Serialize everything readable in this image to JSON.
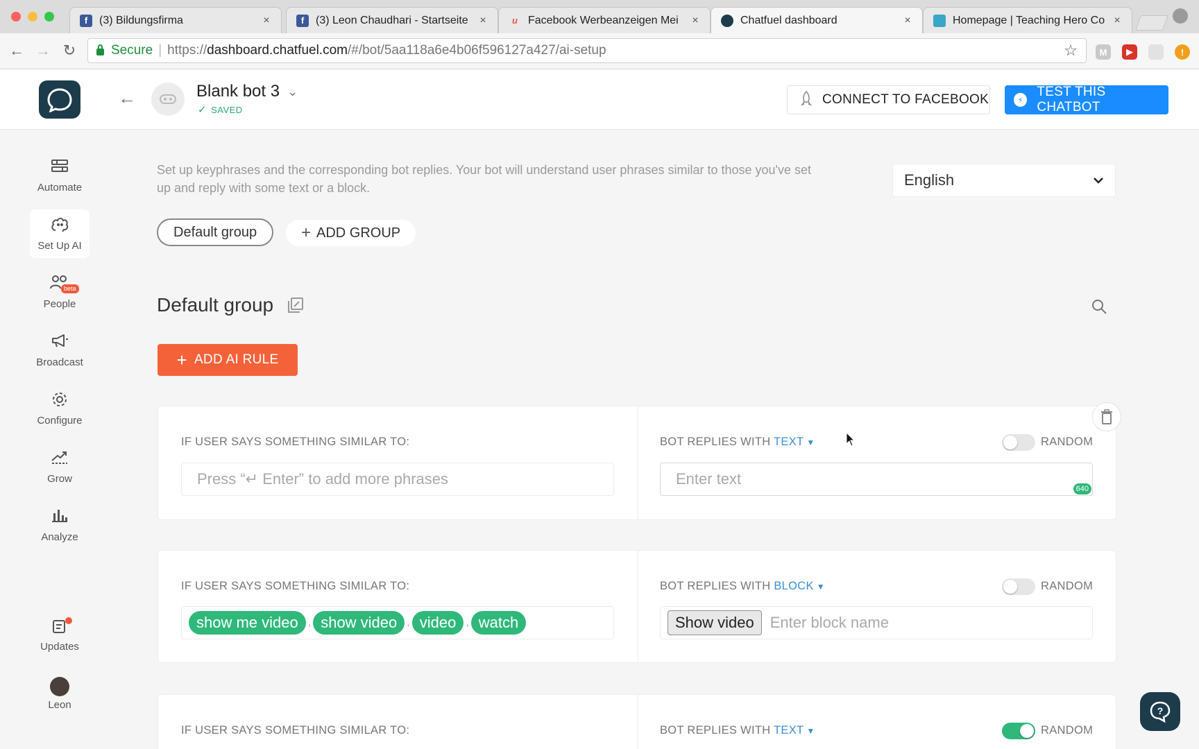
{
  "browser": {
    "tabs": [
      {
        "title": "(3) Bildungsfirma",
        "favicon": "facebook-icon",
        "color": "#3b5998"
      },
      {
        "title": "(3) Leon Chaudhari - Startseite",
        "favicon": "facebook-icon",
        "color": "#3b5998"
      },
      {
        "title": "Facebook Werbeanzeigen Mei",
        "favicon": "udemy-icon",
        "color": "#ec5252"
      },
      {
        "title": "Chatfuel dashboard",
        "favicon": "chatfuel-icon",
        "color": "#1c3c4c"
      },
      {
        "title": "Homepage | Teaching Hero Co",
        "favicon": "teachinghero-icon",
        "color": "#3aa6c8"
      }
    ],
    "tab_close": "×",
    "url": {
      "secure_label": "Secure",
      "scheme": "https://",
      "host": "dashboard.chatfuel.com",
      "path": "/#/bot/5aa118a6e4b06f596127a427/ai-setup"
    }
  },
  "header": {
    "bot_name": "Blank bot 3",
    "saved_label": "SAVED",
    "connect_label": "CONNECT TO FACEBOOK",
    "test_label": "TEST THIS CHATBOT",
    "accent": "#1a8cff"
  },
  "sidebar": {
    "items": [
      {
        "label": "Automate",
        "icon": "automate-icon"
      },
      {
        "label": "Set Up AI",
        "icon": "ai-brain-icon",
        "active": true
      },
      {
        "label": "People",
        "icon": "people-icon",
        "badge": "beta"
      },
      {
        "label": "Broadcast",
        "icon": "megaphone-icon"
      },
      {
        "label": "Configure",
        "icon": "gear-icon"
      },
      {
        "label": "Grow",
        "icon": "grow-icon"
      },
      {
        "label": "Analyze",
        "icon": "bar-chart-icon"
      },
      {
        "label": "Updates",
        "icon": "updates-icon"
      },
      {
        "label": "Leon",
        "icon": "user-avatar"
      }
    ]
  },
  "main": {
    "intro": "Set up keyphrases and the corresponding bot replies. Your bot will understand user phrases similar to those you've set up and reply with some text or a block.",
    "language": "English",
    "groups": [
      "Default group"
    ],
    "add_group_label": "ADD GROUP",
    "group_title": "Default group",
    "add_rule_label": "ADD AI RULE",
    "rules": [
      {
        "user_label": "IF USER SAYS SOMETHING SIMILAR TO:",
        "bot_label": "BOT REPLIES WITH",
        "reply_type": "TEXT",
        "random_label": "RANDOM",
        "random_on": false,
        "phrase_placeholder": "Press “↵ Enter” to add more phrases",
        "reply_placeholder": "Enter text",
        "char_limit": "640",
        "phrases": []
      },
      {
        "user_label": "IF USER SAYS SOMETHING SIMILAR TO:",
        "bot_label": "BOT REPLIES WITH",
        "reply_type": "BLOCK",
        "random_label": "RANDOM",
        "random_on": false,
        "phrases": [
          "show me video",
          "show video",
          "video",
          "watch"
        ],
        "block_selected": "Show video",
        "block_placeholder": "Enter block name"
      },
      {
        "user_label": "IF USER SAYS SOMETHING SIMILAR TO:",
        "bot_label": "BOT REPLIES WITH",
        "reply_type": "TEXT",
        "random_label": "RANDOM",
        "random_on": true
      }
    ]
  }
}
